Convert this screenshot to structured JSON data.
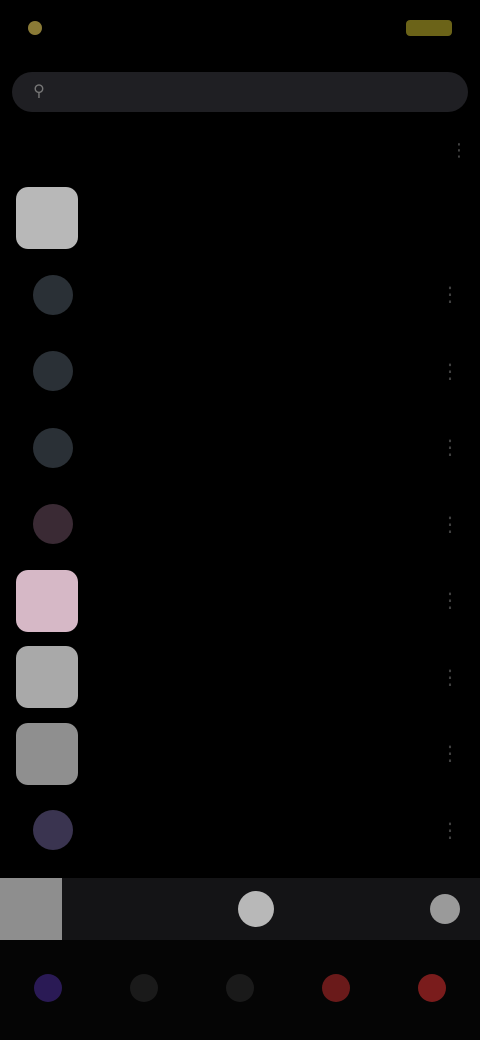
{
  "status": {
    "time": "",
    "battery_color": "#6b6318",
    "dot_color": "#8a7a36"
  },
  "search": {
    "placeholder": "",
    "icon": "search-icon"
  },
  "library": {
    "title": "",
    "items": [
      {
        "title": "",
        "color": "#b8b8b8",
        "shape": "square"
      },
      {
        "title": "",
        "color": "#2a3036",
        "shape": "circle"
      },
      {
        "title": "",
        "color": "#2a3036",
        "shape": "circle"
      },
      {
        "title": "",
        "color": "#2a3036",
        "shape": "circle"
      },
      {
        "title": "",
        "color": "#3a2a34",
        "shape": "circle"
      },
      {
        "title": "",
        "color": "#d6b8c6",
        "shape": "square"
      },
      {
        "title": "",
        "color": "#a9a9a9",
        "shape": "square"
      },
      {
        "title": "",
        "color": "#8f8f8f",
        "shape": "square"
      },
      {
        "title": "",
        "color": "#3a3450",
        "shape": "circle"
      }
    ]
  },
  "mini_player": {
    "title": "",
    "art_color": "#8e8e8e"
  },
  "tabs": [
    {
      "label": "",
      "color": "#2a1a55"
    },
    {
      "label": "",
      "color": "#1a1a1a"
    },
    {
      "label": "",
      "color": "#1a1a1a"
    },
    {
      "label": "",
      "color": "#6a1a1a"
    },
    {
      "label": "",
      "color": "#7a1c1c"
    }
  ]
}
